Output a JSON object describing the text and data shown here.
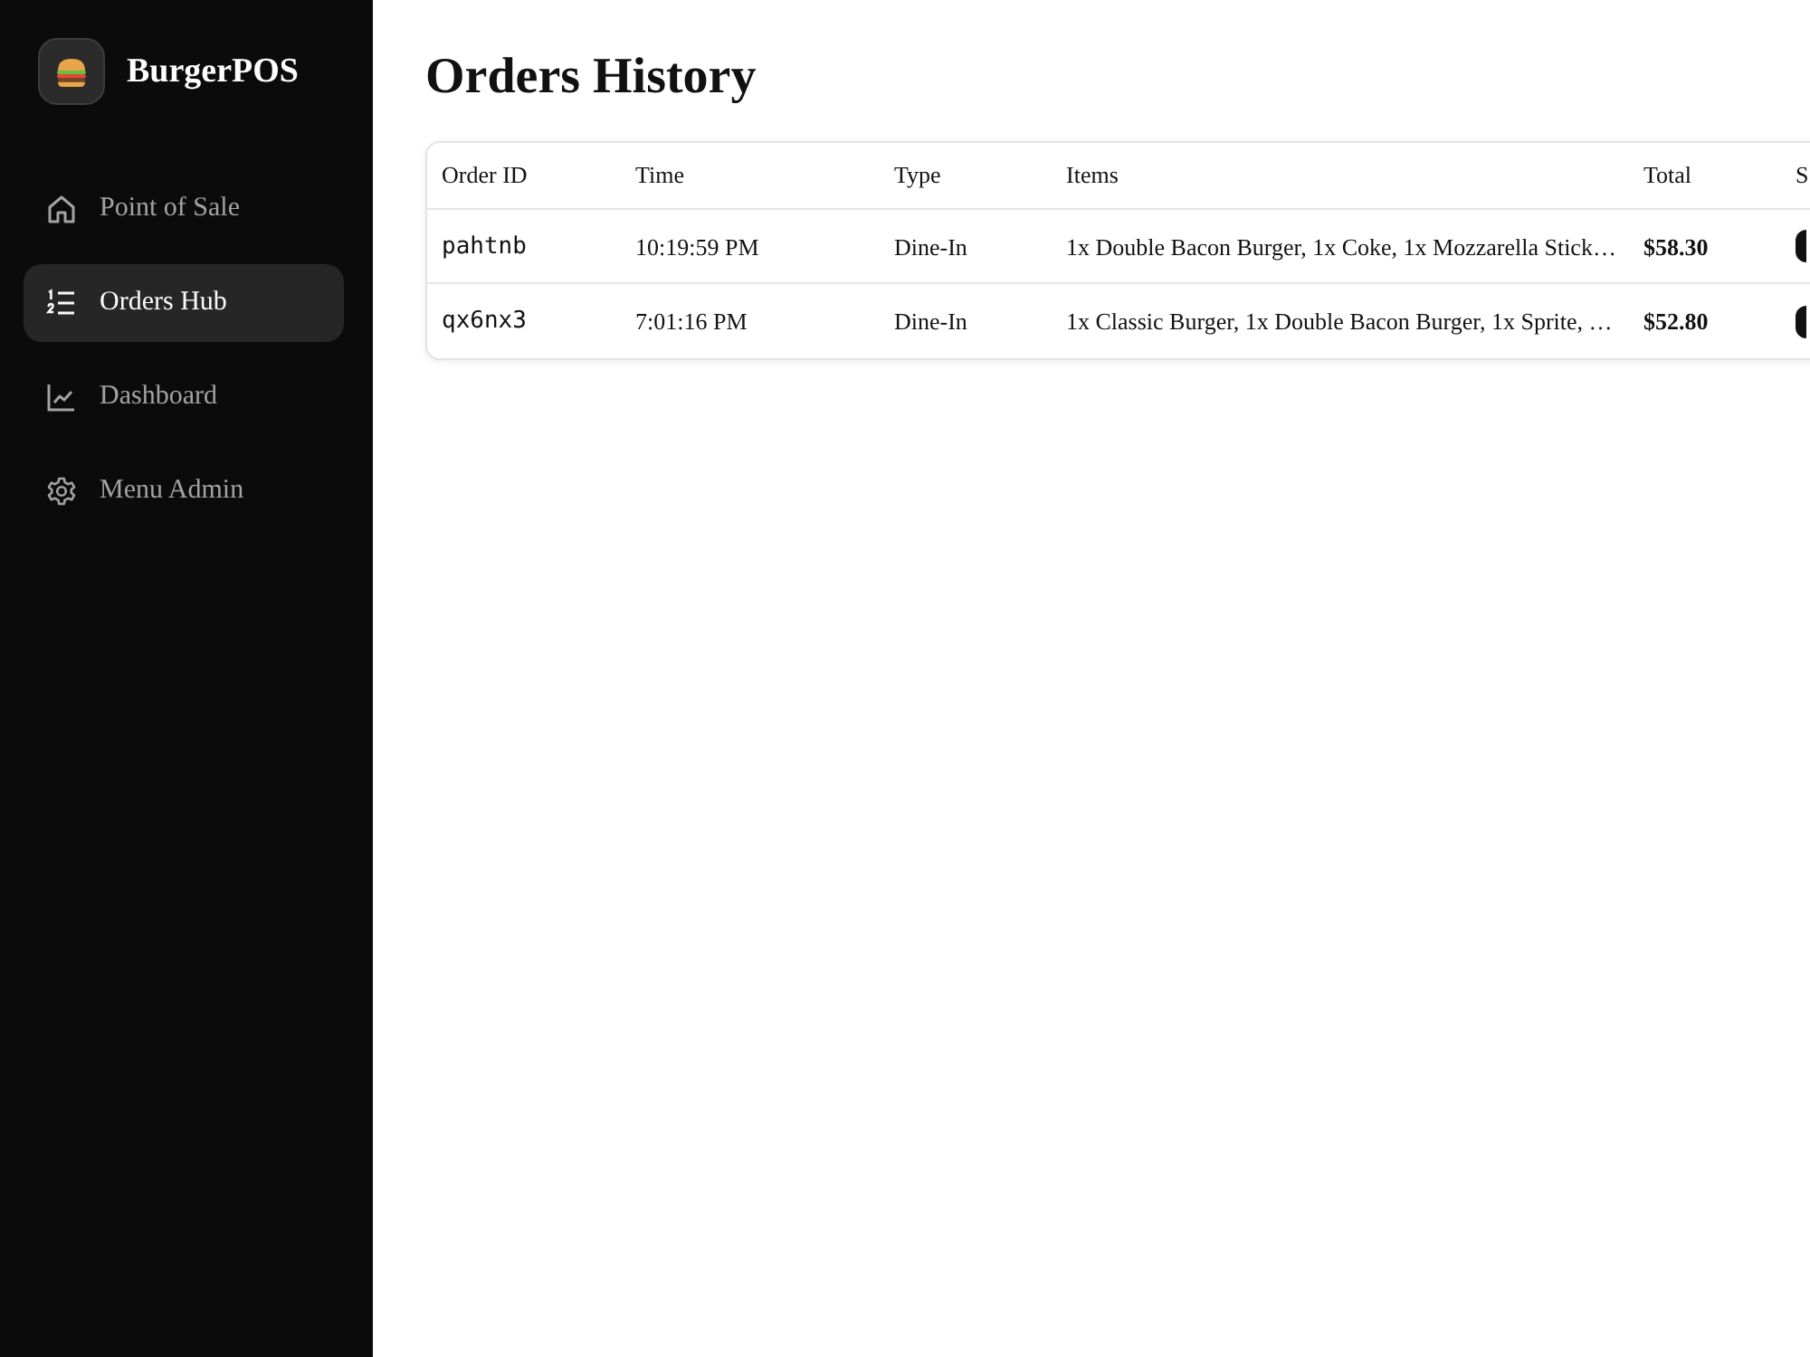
{
  "sidebar": {
    "brand": "BurgerPOS",
    "nav": [
      {
        "label": "Point of Sale",
        "selected": false
      },
      {
        "label": "Orders Hub",
        "selected": true
      },
      {
        "label": "Dashboard",
        "selected": false
      },
      {
        "label": "Menu Admin",
        "selected": false
      }
    ]
  },
  "page": {
    "title": "Orders History"
  },
  "table": {
    "columns": [
      "Order ID",
      "Time",
      "Type",
      "Items",
      "Total",
      "S"
    ],
    "rows": [
      {
        "order_id": "pahtnb",
        "time": "10:19:59 PM",
        "type": "Dine-In",
        "items": "1x Double Bacon Burger, 1x Coke, 1x Mozzarella Stick…",
        "total": "$58.30"
      },
      {
        "order_id": "qx6nx3",
        "time": "7:01:16 PM",
        "type": "Dine-In",
        "items": "1x Classic Burger, 1x Double Bacon Burger, 1x Sprite, …",
        "total": "$52.80"
      }
    ]
  }
}
